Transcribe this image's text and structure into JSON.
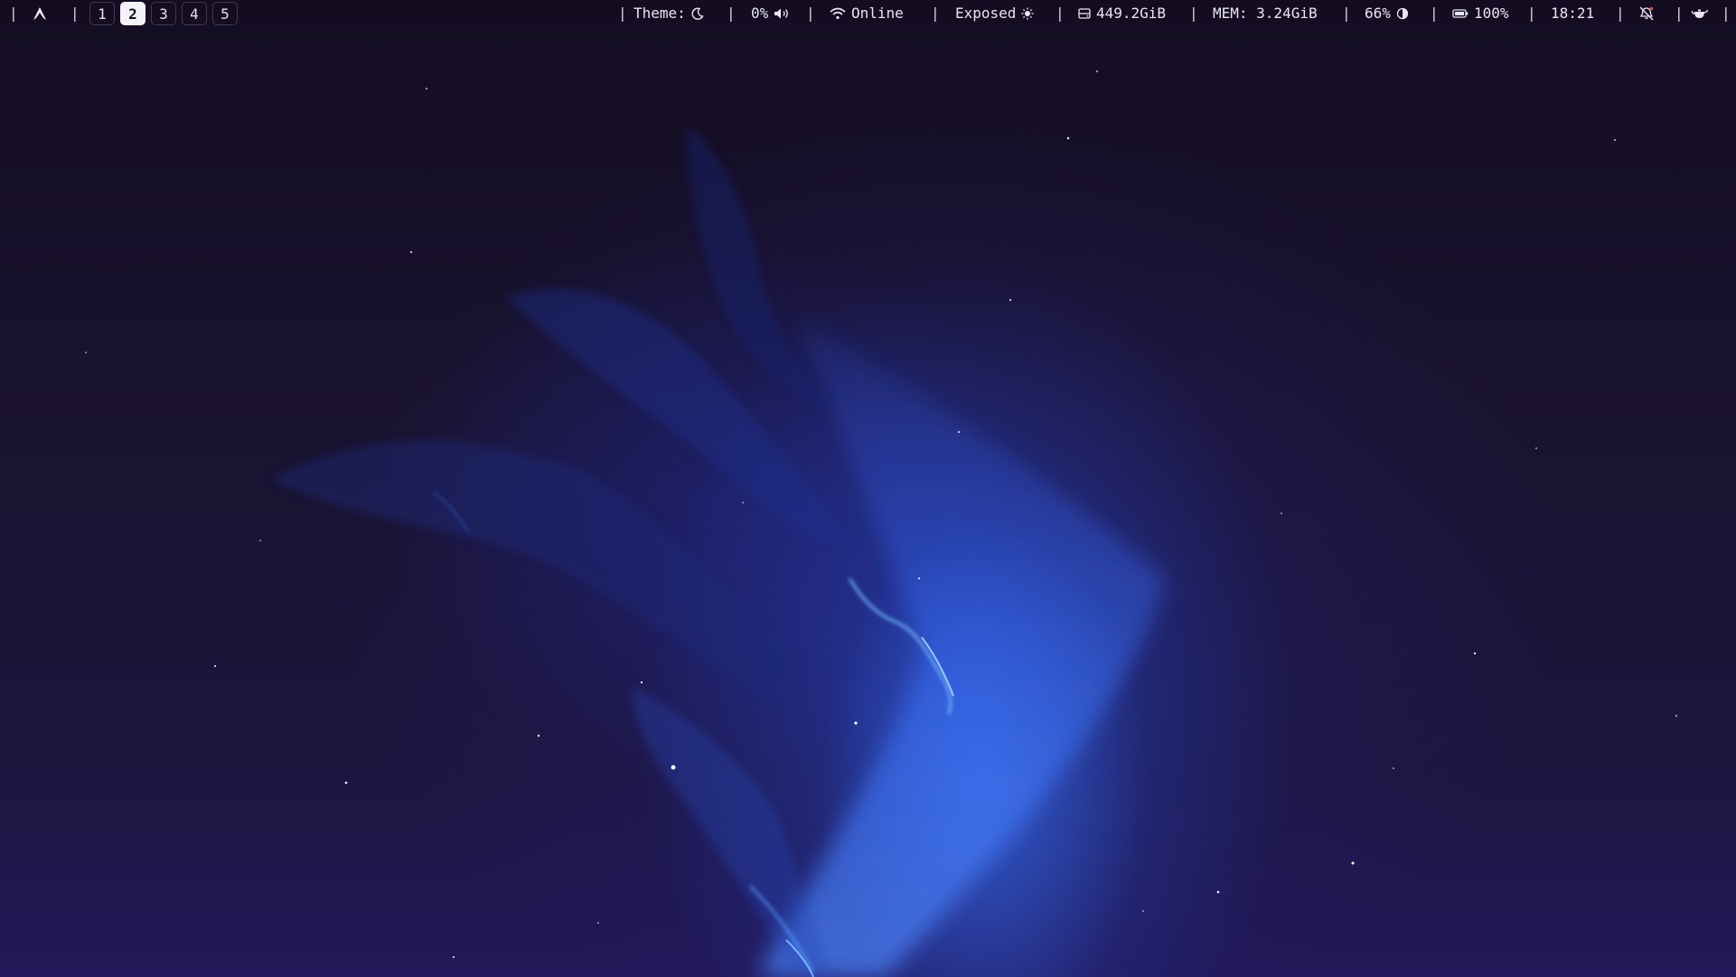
{
  "workspaces": [
    "1",
    "2",
    "3",
    "4",
    "5"
  ],
  "active_workspace": "2",
  "status": {
    "theme_label": "Theme:",
    "theme_icon": "moon-icon",
    "volume": "0%",
    "volume_icon": "speaker-icon",
    "network_icon": "wifi-icon",
    "network": "Online",
    "exposure": "Exposed",
    "exposure_icon": "sun-icon",
    "disk_icon": "disk-icon",
    "disk": "449.2GiB",
    "memory": "MEM: 3.24GiB",
    "brightness": "66%",
    "brightness_icon": "half-circle-icon",
    "battery_icon": "battery-icon",
    "battery": "100%",
    "time": "18:21",
    "notifications_icon": "bell-off-icon",
    "tray_icon": "teapot-icon"
  },
  "separator": "|",
  "colors": {
    "bar_text": "#e8e6ef",
    "active_workspace_bg": "#f4f2f8",
    "nebula_glow": "#2f6bff",
    "sky_dark": "#140d22"
  }
}
